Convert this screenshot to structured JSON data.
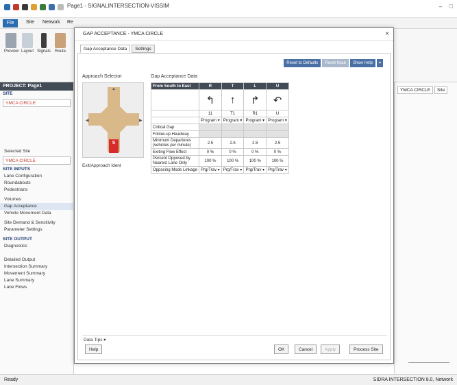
{
  "app": {
    "title": "Page1 - SIGNALINTERSECTION-VISSIM",
    "minimize": "–",
    "maximize": "□"
  },
  "ribbon": {
    "file_tab": "File",
    "tabs": [
      "Site",
      "Network",
      "Re"
    ],
    "buttons": [
      "Preview",
      "Layout",
      "Signals",
      "Route"
    ]
  },
  "left_panel": {
    "project_header": "PROJECT: Page1",
    "site_label": "SITE",
    "site_value": "YMCA CIRCLE",
    "selected_site_label": "Selected Site",
    "selected_site_value": "YMCA CIRCLE",
    "site_inputs_label": "SITE INPUTS",
    "items_a": [
      "Lane Configuration",
      "Roundabouts",
      "Pedestrians"
    ],
    "items_b": [
      "Volumes",
      "Gap Acceptance",
      "Vehicle Movement Data"
    ],
    "items_c": [
      "Site Demand & Sensitivity",
      "Parameter Settings"
    ],
    "site_output_label": "SITE OUTPUT",
    "items_d": [
      "Diagnostics"
    ],
    "items_e": [
      "Detailed Output",
      "Intersection Summary",
      "Movement Summary",
      "Lane Summary",
      "Lane Flows"
    ]
  },
  "dialog": {
    "title": "GAP ACCEPTANCE - YMCA CIRCLE",
    "tabs": [
      "Gap Acceptance Data",
      "Settings"
    ],
    "top_buttons": [
      "Reset to Defaults",
      "Reset Input",
      "Show Help"
    ],
    "approach_selector": "Approach Selector",
    "approach_tag": "S",
    "gap_data_title": "Gap Acceptance Data",
    "grid": {
      "header": [
        "From South to East",
        "R",
        "T",
        "L",
        "U"
      ],
      "arrows": [
        "↰",
        "↑",
        "↱",
        "↶"
      ],
      "codes": [
        "11",
        "T1",
        "R1",
        "U"
      ],
      "modes": [
        "Program",
        "Program",
        "Program",
        "Program"
      ],
      "critical_gap_label": "Critical Gap",
      "follow_up_label": "Follow-up Headway",
      "min_departures_label": "Minimum Departures (vehicles per minute)",
      "min_departures": [
        "2.5",
        "2.5",
        "2.5",
        "2.5"
      ],
      "exiting_flow_label": "Exiting Flow Effect",
      "exiting_flow": [
        "0 %",
        "0 %",
        "0 %",
        "0 %"
      ],
      "percent_opposed_label": "Percent Opposed by Nearest Lane Only",
      "percent_opposed": [
        "100 %",
        "100 %",
        "100 %",
        "100 %"
      ],
      "opposing_mode_label": "Opposing Mode Linkage",
      "opposing_mode": [
        "Prg/Trav",
        "Prg/Trav",
        "Prg/Trav",
        "Prg/Trav"
      ]
    },
    "exit_label": "Exit/Approach Ident",
    "footer_label": "Data Tips",
    "buttons": {
      "help": "Help",
      "ok": "OK",
      "cancel": "Cancel",
      "apply": "Apply",
      "process": "Process Site"
    }
  },
  "right_panel": {
    "tab": "YMCA CIRCLE",
    "tab2": "Site"
  },
  "status": {
    "left": "Ready",
    "right": "SIDRA INTERSECTION 8.0, Network"
  },
  "colors": {
    "accent": "#2b6cb0",
    "header": "#434b57",
    "approach": "#d9b98a",
    "active": "#d62b2b"
  }
}
